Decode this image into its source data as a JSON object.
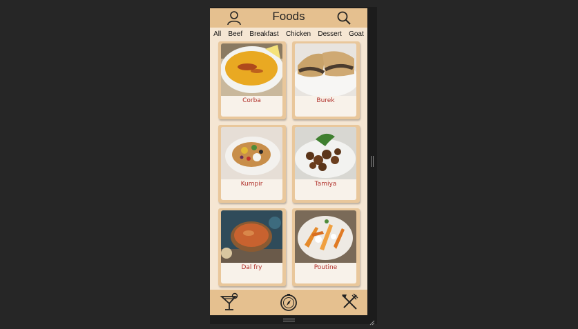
{
  "app": {
    "title": "Foods"
  },
  "categories": [
    "All",
    "Beef",
    "Breakfast",
    "Chicken",
    "Dessert",
    "Goat"
  ],
  "foods": [
    {
      "name": "Corba"
    },
    {
      "name": "Burek"
    },
    {
      "name": "Kumpir"
    },
    {
      "name": "Tamiya"
    },
    {
      "name": "Dal fry"
    },
    {
      "name": "Poutine"
    }
  ],
  "icons": {
    "profile": "user-icon",
    "search": "search-icon",
    "drinks": "cocktail-icon",
    "explore": "compass-icon",
    "food": "utensils-icon"
  },
  "colors": {
    "bar": "#e5c08f",
    "background": "#f5e6d3",
    "card": "#e9c79b",
    "label": "#b0302a"
  }
}
